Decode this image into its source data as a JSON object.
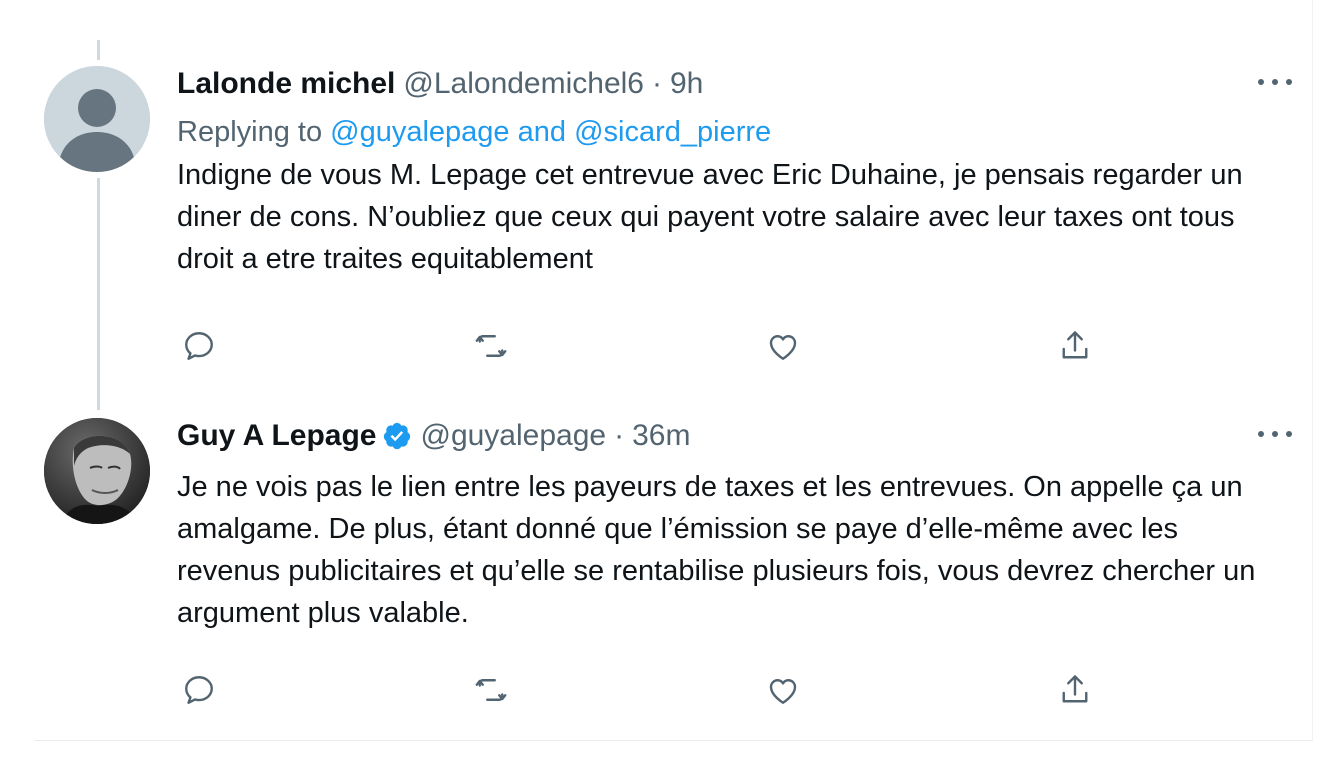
{
  "colors": {
    "text": "#0f1419",
    "secondary": "#536471",
    "link": "#1d9bf0",
    "thread_line": "#cfd9de",
    "verified": "#1d9bf0"
  },
  "tweets": [
    {
      "name": "Lalonde michel",
      "handle": "@Lalondemichel6",
      "separator": "·",
      "time": "9h",
      "verified": false,
      "replying_prefix": "Replying to ",
      "replying_user1": "@guyalepage",
      "replying_and": " and ",
      "replying_user2": "@sicard_pierre",
      "text": "Indigne de vous M. Lepage cet entrevue avec Eric Duhaine, je pensais regarder un diner de cons. N’oubliez que ceux qui payent votre salaire avec leur taxes ont tous droit a etre traites equitablement",
      "avatar": "default-avatar"
    },
    {
      "name": "Guy A Lepage",
      "handle": "@guyalepage",
      "separator": "·",
      "time": "36m",
      "verified": true,
      "text": "Je ne vois pas le lien entre les payeurs de taxes et les entrevues. On appelle ça un amalgame. De plus, étant donné que l’émission se paye d’elle-même avec les revenus publicitaires et qu’elle se rentabilise plusieurs fois, vous devrez chercher un argument plus valable.",
      "avatar": "profile-photo"
    }
  ],
  "action_icons": [
    "reply-icon",
    "retweet-icon",
    "like-icon",
    "share-icon"
  ]
}
